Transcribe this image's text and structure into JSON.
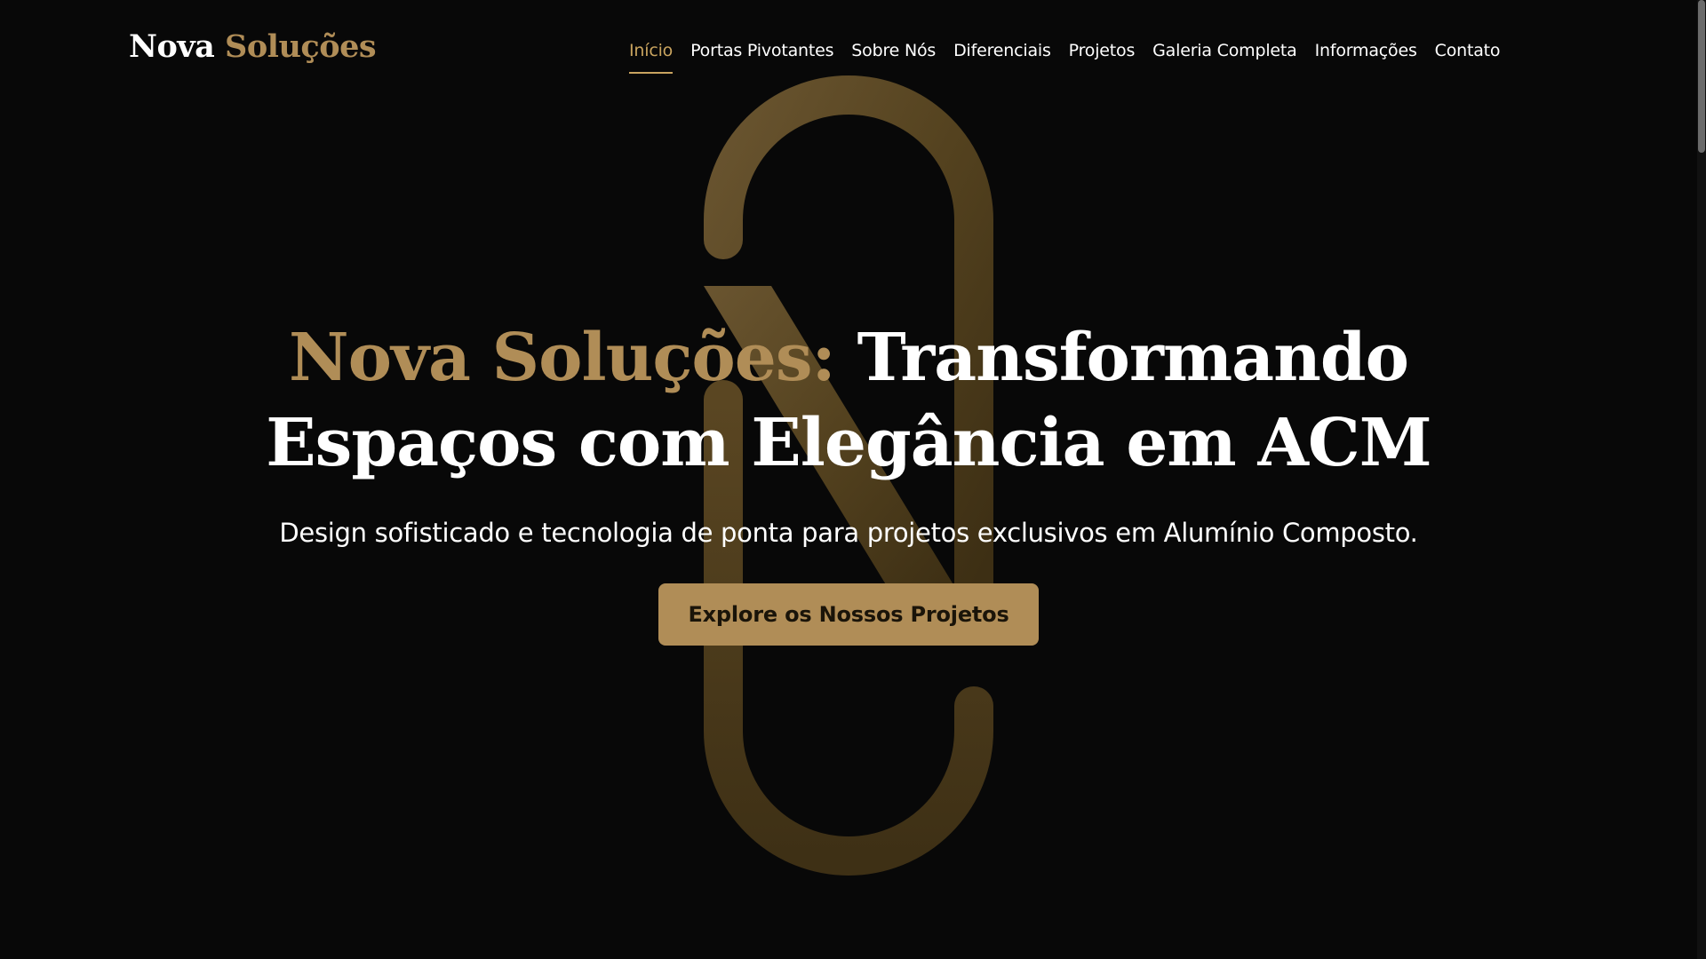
{
  "brand": {
    "logo_part1": "Nova",
    "logo_part2": "Soluções",
    "accent_color": "#b08d57"
  },
  "nav": {
    "items": [
      {
        "label": "Início",
        "active": true
      },
      {
        "label": "Portas Pivotantes",
        "active": false
      },
      {
        "label": "Sobre Nós",
        "active": false
      },
      {
        "label": "Diferenciais",
        "active": false
      },
      {
        "label": "Projetos",
        "active": false
      },
      {
        "label": "Galeria Completa",
        "active": false
      },
      {
        "label": "Informações",
        "active": false
      },
      {
        "label": "Contato",
        "active": false
      }
    ]
  },
  "hero": {
    "title_accent": "Nova Soluções:",
    "title_rest": "Transformando Espaços com Elegância em ACM",
    "subtitle": "Design sofisticado e tecnologia de ponta para projetos exclusivos em Alumínio Composto.",
    "cta_label": "Explore os Nossos Projetos",
    "background_icon": "n-monogram-icon"
  },
  "colors": {
    "background": "#080808",
    "gold": "#b08d57",
    "gold_nav": "#c9a45f",
    "text": "#ffffff"
  }
}
